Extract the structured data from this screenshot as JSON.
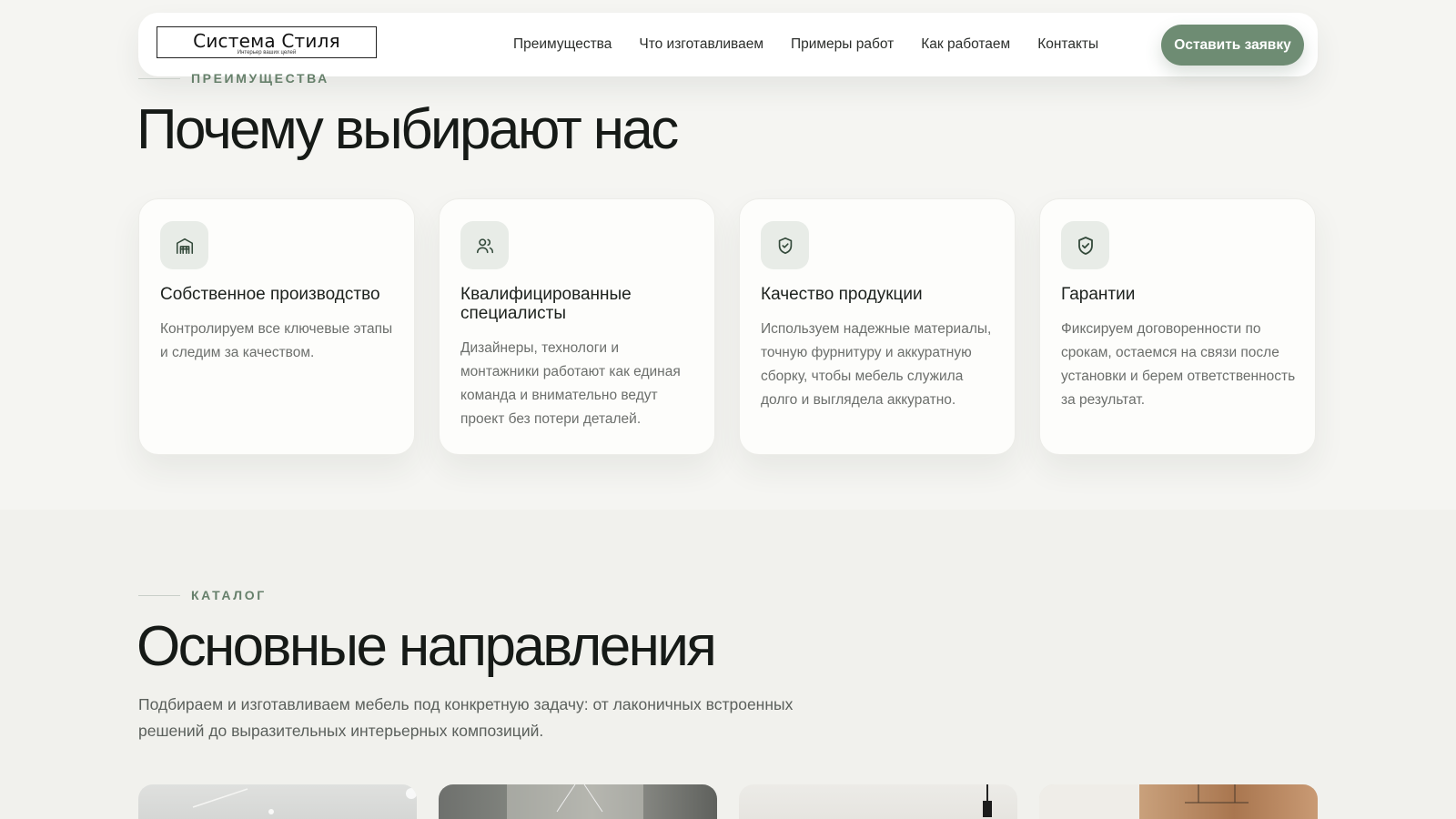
{
  "header": {
    "logo_title": "Система Стиля",
    "logo_tagline": "Интерьер ваших целей",
    "nav": [
      {
        "label": "Преимущества"
      },
      {
        "label": "Что изготавливаем"
      },
      {
        "label": "Примеры работ"
      },
      {
        "label": "Как работаем"
      },
      {
        "label": "Контакты"
      }
    ],
    "cta_label": "Оставить заявку"
  },
  "advantages": {
    "eyebrow": "Преимущества",
    "heading": "Почему выбирают нас",
    "cards": [
      {
        "icon": "factory-icon",
        "title": "Собственное производство",
        "text": "Контролируем все ключевые этапы и следим за качеством."
      },
      {
        "icon": "users-icon",
        "title": "Квалифицированные специалисты",
        "text": "Дизайнеры, технологи и монтажники работают как единая команда и внимательно ведут проект без потери деталей."
      },
      {
        "icon": "shield-check-icon",
        "title": "Качество продукции",
        "text": "Используем надежные материалы, точную фурнитуру и аккуратную сборку, чтобы мебель служила долго и выглядела аккуратно."
      },
      {
        "icon": "shield-check-icon",
        "title": "Гарантии",
        "text": "Фиксируем договоренности по срокам, остаемся на связи после установки и берем ответственность за результат."
      }
    ]
  },
  "catalog": {
    "eyebrow": "Каталог",
    "heading": "Основные направления",
    "lead": "Подбираем и изготавливаем мебель под конкретную задачу: от лаконичных встроенных решений до выразительных интерьерных композиций."
  },
  "colors": {
    "accent": "#6e8c73",
    "eyebrow": "#66806b",
    "heading": "#161a17",
    "background": "#f5f5f2"
  }
}
